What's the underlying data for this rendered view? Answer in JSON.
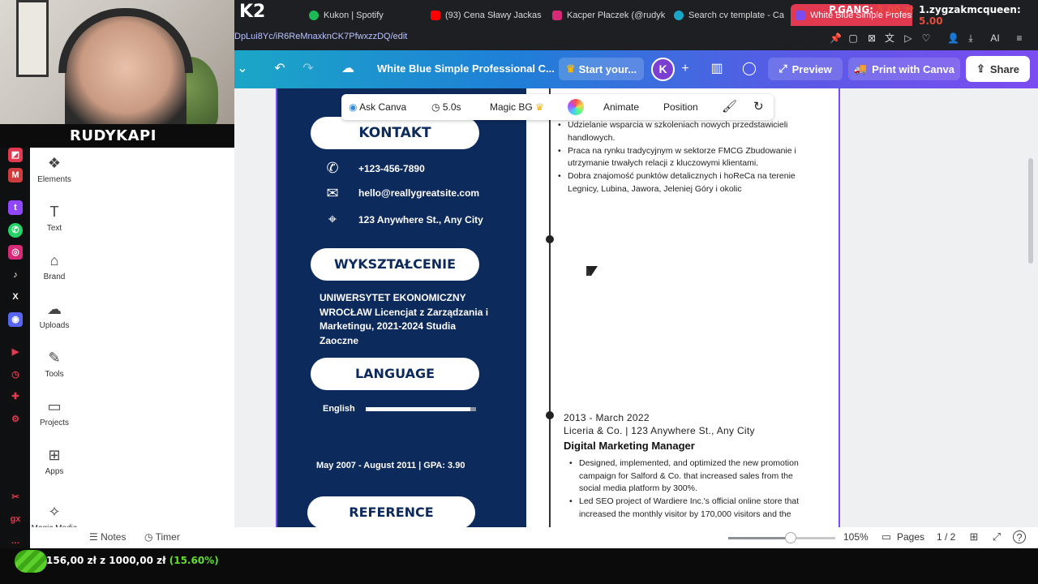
{
  "stream": {
    "streamer_name": "RUDYKAPI",
    "donor_1": {
      "name": "P.GANG:",
      "amount": "5.00 zł"
    },
    "donor_2": {
      "name": "1.zygzakmcqueen:",
      "amount": "5.00"
    },
    "donation_goal": {
      "current": "156,00 zł",
      "sep": "z",
      "target": "1000,00 zł",
      "percent": "(15.60%)",
      "progress_fraction": 0.156
    }
  },
  "browser": {
    "logo": "K2",
    "tabs": [
      {
        "label": "Kukon | Spotify",
        "color": "#1db954"
      },
      {
        "label": "(93) Cena Sławy Jackas",
        "color": "#ff0000"
      },
      {
        "label": "Kacper Płaczek (@rudyk",
        "color": "#d62976"
      },
      {
        "label": "Search cv template - Ca",
        "color": "#1ba6c7"
      },
      {
        "label": "White Blue Simple Professi",
        "color": "#7c4cf0"
      }
    ],
    "url": "DpLui8Yc/iR6ReMnaxknCK7PfwxzzDQ/edit"
  },
  "canva": {
    "doc_title": "White Blue Simple Professional C...",
    "start_trial": "Start your...",
    "avatar_initial": "K",
    "preview": "Preview",
    "print": "Print with Canva",
    "share": "Share",
    "rail": [
      {
        "label": "Elements",
        "icon": "elements-icon"
      },
      {
        "label": "Text",
        "icon": "text-icon"
      },
      {
        "label": "Brand",
        "icon": "brand-icon"
      },
      {
        "label": "Uploads",
        "icon": "uploads-icon"
      },
      {
        "label": "Tools",
        "icon": "tools-icon"
      },
      {
        "label": "Projects",
        "icon": "projects-icon"
      },
      {
        "label": "Apps",
        "icon": "apps-icon"
      },
      {
        "label": "Magic Media",
        "icon": "magic-media-icon"
      }
    ],
    "float_toolbar": {
      "ask": "Ask Canva",
      "duration": "5.0s",
      "magic_bg": "Magic BG",
      "animate": "Animate",
      "position": "Position"
    },
    "bottom": {
      "notes": "Notes",
      "timer": "Timer",
      "zoom": "105%",
      "zoom_fraction": 0.58,
      "pages_label": "Pages",
      "pages_count": "1 / 2"
    }
  },
  "resume": {
    "contact_heading": "KONTAKT",
    "phone": "+123-456-7890",
    "email": "hello@reallygreatsite.com",
    "address": "123 Anywhere St., Any City",
    "education_heading": "WYKSZTAŁCENIE",
    "education_text": "UNIWERSYTET EKONOMICZNY WROCŁAW Licencjat z Zarządzania i Marketingu, 2021-2024 Studia Zaoczne",
    "language_heading": "LANGUAGE",
    "language_name": "English",
    "language_level": 0.95,
    "gpa_line": "May 2007 - August 2011 | GPA: 3.90",
    "reference_heading": "REFERENCE",
    "job1_bullets": [
      "Udzielanie wsparcia w szkoleniach nowych przedstawicieli handlowych.",
      "Praca na rynku tradycyjnym w sektorze FMCG Zbudowanie i utrzymanie trwałych relacji z kluczowymi klientami.",
      "Dobra znajomość punktów detalicznych i hoReCa na terenie Legnicy, Lubina, Jawora, Jeleniej Góry i okolic"
    ],
    "job2": {
      "dates": "2013 - March 2022",
      "company": "Liceria & Co. | 123 Anywhere St., Any City",
      "title": "Digital Marketing Manager",
      "bullets": [
        "Designed, implemented, and optimized the new promotion campaign for Salford & Co. that increased sales from the social media platform by 300%.",
        "Led SEO project of Wardiere Inc.'s official online store that increased the monthly visitor by 170,000 visitors and the"
      ]
    }
  }
}
